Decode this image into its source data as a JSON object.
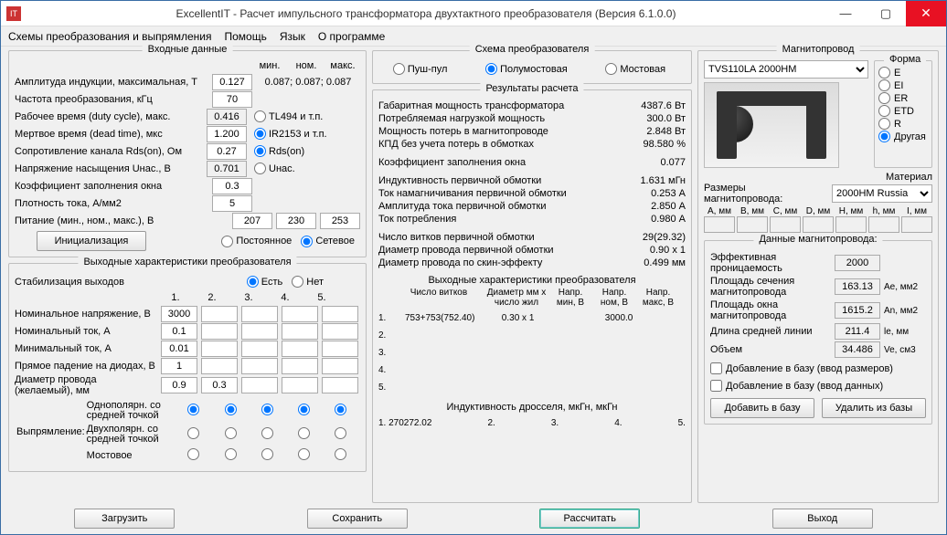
{
  "window": {
    "title": "ExcellentIT - Расчет импульсного трансформатора двухтактного преобразователя (Версия 6.1.0.0)"
  },
  "menu": {
    "schemes": "Схемы преобразования и выпрямления",
    "help": "Помощь",
    "lang": "Язык",
    "about": "О программе"
  },
  "input": {
    "title": "Входные данные",
    "min": "мин.",
    "nom": "ном.",
    "max": "макс.",
    "amp_b_label": "Амплитуда индукции, максимальная, Т",
    "amp_b": "0.127",
    "amp_b_hint": "0.087; 0.087; 0.087",
    "freq_label": "Частота преобразования, кГц",
    "freq": "70",
    "duty_label": "Рабочее время (duty cycle), макс.",
    "duty": "0.416",
    "dead_label": "Мертвое время (dead time), мкс",
    "dead": "1.200",
    "rds_label": "Сопротивление канала Rds(on), Ом",
    "rds": "0.27",
    "unas_label": "Напряжение насыщения Uнас., В",
    "unas": "0.701",
    "kfill_label": "Коэффициент заполнения окна",
    "kfill": "0.3",
    "jdens_label": "Плотность тока, А/мм2",
    "jdens": "5",
    "supply_label": "Питание (мин., ном., макс.), В",
    "supply_min": "207",
    "supply_nom": "230",
    "supply_max": "253",
    "init_btn": "Инициализация",
    "chip_tl494": "TL494 и т.п.",
    "chip_ir2153": "IR2153 и т.п.",
    "rdson": "Rds(on)",
    "unas_r": "Uнас.",
    "src_const": "Постоянное",
    "src_mains": "Сетевое"
  },
  "outchar": {
    "title": "Выходные характеристики преобразователя",
    "stab_label": "Стабилизация выходов",
    "stab_yes": "Есть",
    "stab_no": "Нет",
    "c1": "1.",
    "c2": "2.",
    "c3": "3.",
    "c4": "4.",
    "c5": "5.",
    "vnom_label": "Номинальное напряжение, В",
    "vnom": "3000",
    "inom_label": "Номинальный ток, А",
    "inom": "0.1",
    "imin_label": "Минимальный ток, А",
    "imin": "0.01",
    "vdrop_label": "Прямое падение на диодах, В",
    "vdrop": "1",
    "dwire_label": "Диаметр провода (желаемый), мм",
    "dwire1": "0.9",
    "dwire2": "0.3",
    "rect_label": "Выпрямление:",
    "rect_a": "Однополярн. со средней точкой",
    "rect_b": "Двухполярн. со средней точкой",
    "rect_c": "Мостовое"
  },
  "scheme": {
    "title": "Схема преобразователя",
    "push": "Пуш-пул",
    "half": "Полумостовая",
    "full": "Мостовая"
  },
  "results": {
    "title": "Результаты расчета",
    "r1l": "Габаритная мощность трансформатора",
    "r1v": "4387.6 Вт",
    "r2l": "Потребляемая нагрузкой мощность",
    "r2v": "300.0 Вт",
    "r3l": "Мощность потерь в магнитопроводе",
    "r3v": "2.848 Вт",
    "r4l": "КПД без учета потерь в обмотках",
    "r4v": "98.580 %",
    "r5l": "Коэффициент заполнения окна",
    "r5v": "0.077",
    "r6l": "Индуктивность первичной обмотки",
    "r6v": "1.631 мГн",
    "r7l": "Ток намагничивания первичной обмотки",
    "r7v": "0.253 А",
    "r8l": "Амплитуда тока первичной обмотки",
    "r8v": "2.850 А",
    "r9l": "Ток потребления",
    "r9v": "0.980 А",
    "r10l": "Число витков первичной обмотки",
    "r10v": "29(29.32)",
    "r11l": "Диаметр провода первичной обмотки",
    "r11v": "0.90 x 1",
    "r12l": "Диаметр провода по скин-эффекту",
    "r12v": "0.499 мм",
    "sub_title": "Выходные характеристики преобразователя",
    "colA": "Число витков",
    "colB": "Диаметр мм х число жил",
    "colC": "Напр. мин, В",
    "colD": "Напр. ном, В",
    "colE": "Напр. макс, В",
    "o1n": "1.",
    "o1a": "753+753(752.40)",
    "o1b": "0.30 x 1",
    "o1d": "3000.0",
    "o2n": "2.",
    "o3n": "3.",
    "o4n": "4.",
    "o5n": "5.",
    "ind_title": "Индуктивность дросселя, мкГн, мкГн",
    "i1": "1. 270272.02",
    "i2": "2.",
    "i3": "3.",
    "i4": "4.",
    "i5": "5."
  },
  "core": {
    "title": "Магнитопровод",
    "select": "TVS110LA 2000HM",
    "shape_title": "Форма",
    "sE": "E",
    "sEI": "EI",
    "sER": "ER",
    "sETD": "ETD",
    "sR": "R",
    "sOther": "Другая",
    "mat_title": "Материал",
    "mat": "2000HM Russia",
    "dim_title": "Размеры магнитопровода:",
    "dA": "A, мм",
    "dB": "B, мм",
    "dC": "C, мм",
    "dD": "D, мм",
    "dH": "H, мм",
    "dh": "h, мм",
    "dI": "I, мм",
    "data_title": "Данные магнитопровода:",
    "perm_l": "Эффективная проницаемость",
    "perm": "2000",
    "ae_l": "Площадь сечения магнитопровода",
    "ae": "163.13",
    "ae_u": "Ae, мм2",
    "an_l": "Площадь окна магнитопровода",
    "an": "1615.2",
    "an_u": "An, мм2",
    "le_l": "Длина средней линии",
    "le": "211.4",
    "le_u": "le, мм",
    "ve_l": "Объем",
    "ve": "34.486",
    "ve_u": "Ve, см3",
    "chk1": "Добавление в базу (ввод размеров)",
    "chk2": "Добавление в базу (ввод данных)",
    "add": "Добавить в базу",
    "del": "Удалить из базы"
  },
  "footer": {
    "load": "Загрузить",
    "save": "Сохранить",
    "calc": "Рассчитать",
    "exit": "Выход"
  }
}
